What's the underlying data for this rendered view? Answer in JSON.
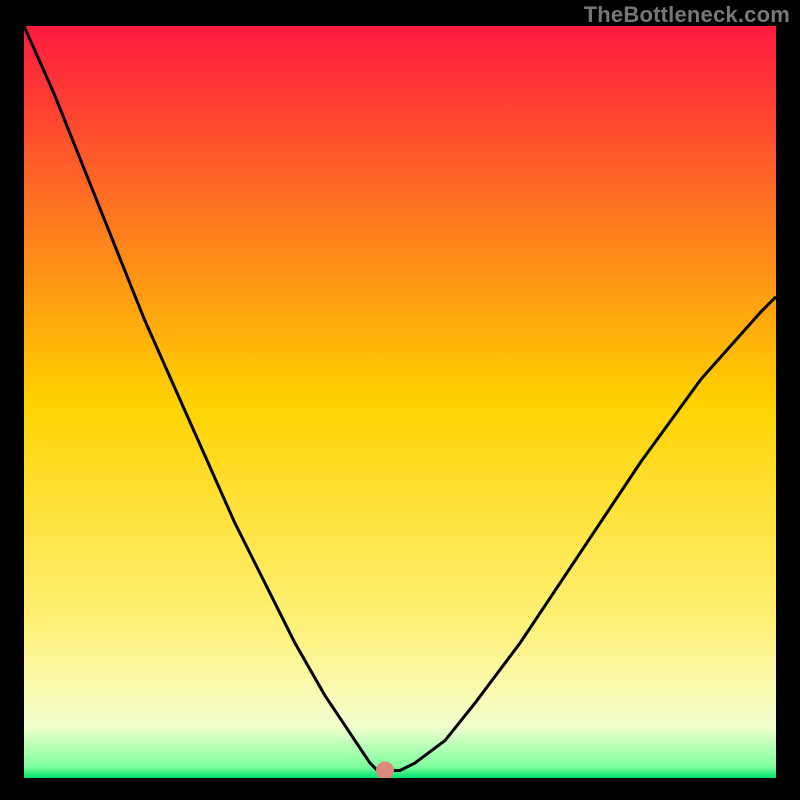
{
  "watermark": {
    "text": "TheBottleneck.com"
  },
  "chart_data": {
    "type": "line",
    "title": "",
    "xlabel": "",
    "ylabel": "",
    "xlim": [
      0,
      100
    ],
    "ylim": [
      0,
      100
    ],
    "grid": false,
    "legend": false,
    "background_gradient": {
      "stops": [
        {
          "offset": 0.0,
          "color": "#ff1940"
        },
        {
          "offset": 0.5,
          "color": "#ffd200"
        },
        {
          "offset": 0.8,
          "color": "#fff27a"
        },
        {
          "offset": 0.93,
          "color": "#f4ffcf"
        },
        {
          "offset": 0.985,
          "color": "#7fff9f"
        },
        {
          "offset": 1.0,
          "color": "#00e06e"
        }
      ]
    },
    "series": [
      {
        "name": "bottleneck-curve",
        "type": "line",
        "color": "#000000",
        "x": [
          0,
          4,
          8,
          12,
          16,
          20,
          24,
          28,
          32,
          36,
          40,
          42,
          44,
          46,
          47,
          48,
          50,
          52,
          56,
          60,
          66,
          74,
          82,
          90,
          98,
          100
        ],
        "y": [
          100,
          91,
          81,
          71,
          61,
          52,
          43,
          34,
          26,
          18,
          11,
          8,
          5,
          2,
          1,
          1,
          1,
          2,
          5,
          10,
          18,
          30,
          42,
          53,
          62,
          64
        ]
      }
    ],
    "marker": {
      "name": "optimal-point",
      "x": 48,
      "y": 1,
      "color": "#d98a7a",
      "radius_pct": 1.2
    }
  }
}
